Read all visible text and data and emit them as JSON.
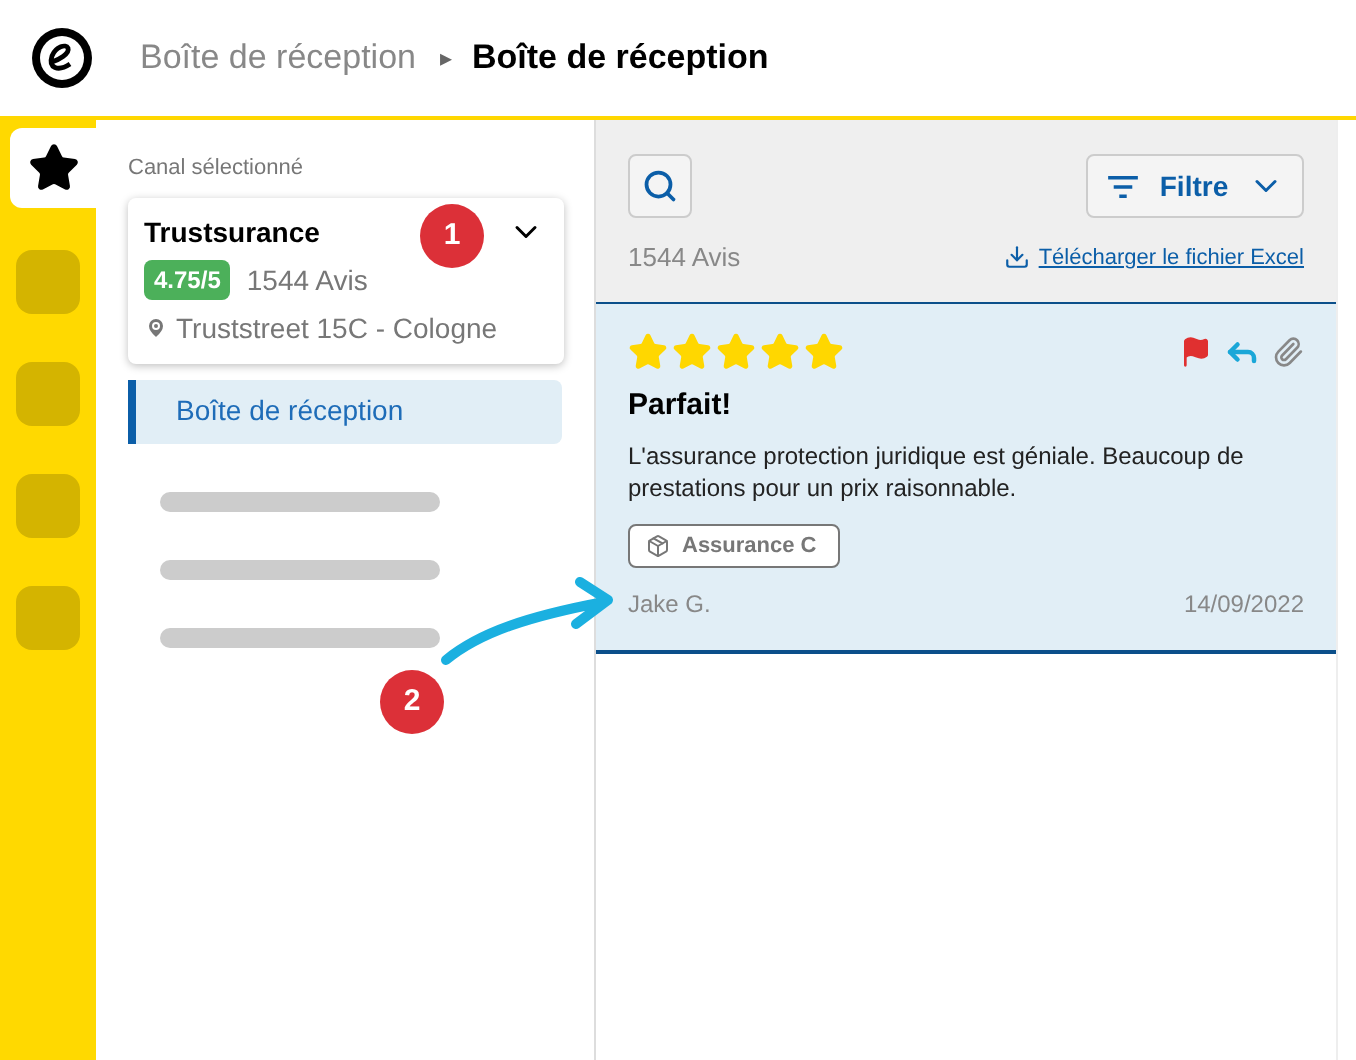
{
  "breadcrumb": {
    "parent": "Boîte de réception",
    "separator": "▸",
    "current": "Boîte de réception"
  },
  "rail": {
    "items": [
      {
        "kind": "star",
        "selected": true
      },
      {
        "kind": "tile",
        "selected": false
      },
      {
        "kind": "tile",
        "selected": false
      },
      {
        "kind": "tile",
        "selected": false
      },
      {
        "kind": "tile",
        "selected": false
      }
    ]
  },
  "sidebar": {
    "caption": "Canal sélectionné",
    "channel": {
      "name": "Trustsurance",
      "rating": "4.75/5",
      "count": "1544 Avis",
      "address": "Truststreet 15C - Cologne"
    },
    "items": [
      {
        "kind": "link",
        "label": "Boîte de réception",
        "selected": true
      },
      {
        "kind": "skeleton",
        "selected": false
      },
      {
        "kind": "skeleton",
        "selected": false
      },
      {
        "kind": "skeleton",
        "selected": false
      }
    ]
  },
  "toolbar": {
    "filter": "Filtre",
    "count": "1544 Avis",
    "download": "Télécharger le fichier Excel"
  },
  "reviews": [
    {
      "stars": 5,
      "title": "Parfait!",
      "text": "L'assurance protection juridique est géniale. Beaucoup de prestations pour un prix raisonnable.",
      "tag": "Assurance C",
      "author": "Jake G.",
      "date": "14/09/2022",
      "flagged": true,
      "replied": true,
      "attachment": true,
      "selected": true
    }
  ],
  "annotations": [
    {
      "label": "1"
    },
    {
      "label": "2"
    }
  ]
}
